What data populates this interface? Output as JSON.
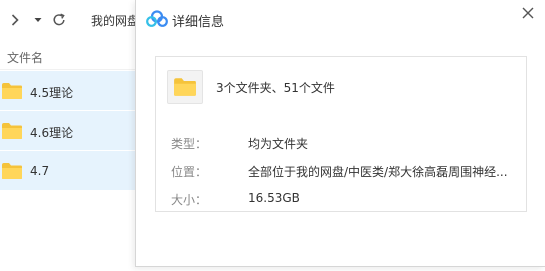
{
  "toolbar": {
    "forward_icon": "chevron-right-icon",
    "dropdown_icon": "caret-down-icon",
    "refresh_icon": "refresh-icon",
    "breadcrumb": "我的网盘"
  },
  "file_list": {
    "header": "文件名",
    "rows": [
      {
        "name": "4.5理论",
        "icon": "folder-icon"
      },
      {
        "name": "4.6理论",
        "icon": "folder-icon"
      },
      {
        "name": "4.7",
        "icon": "folder-icon"
      }
    ]
  },
  "dialog": {
    "title": "详细信息",
    "logo_icon": "cloud-logo-icon",
    "close_icon": "close-icon",
    "summary": "3个文件夹、51个文件",
    "rows": [
      {
        "label": "类型：",
        "value": "均为文件夹"
      },
      {
        "label": "位置：",
        "value": "全部位于我的网盘/中医类/郑大徐高磊周围神经..."
      },
      {
        "label": "大小：",
        "value": "16.53GB"
      }
    ]
  },
  "colors": {
    "selected_row": "#e6f3fd",
    "folder": "#ffd65a",
    "folder_tab": "#f5c33b",
    "logo_blue": "#3b8cf2",
    "logo_cyan": "#35c0e8"
  }
}
